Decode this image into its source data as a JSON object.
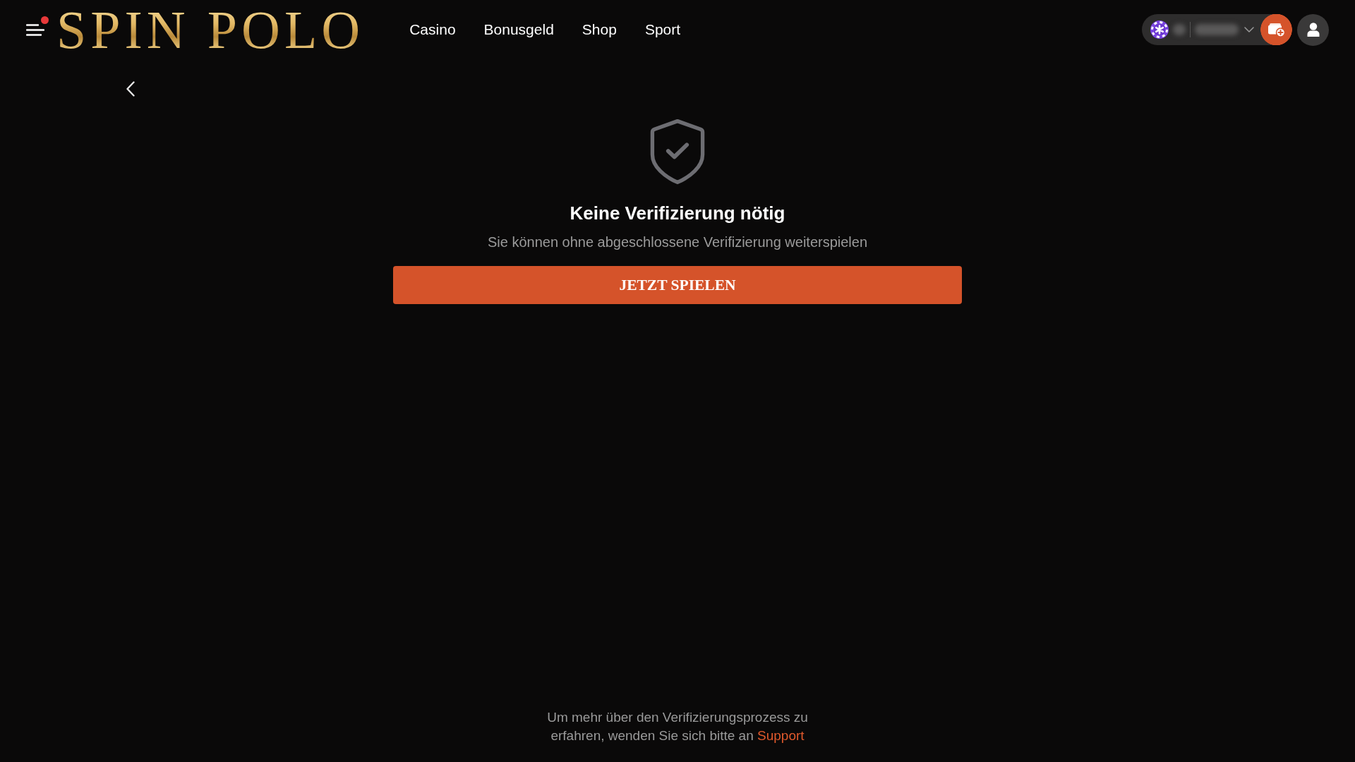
{
  "header": {
    "menu": {
      "has_notification": true
    },
    "logo": "SPIN POLO",
    "nav": [
      {
        "label": "Casino"
      },
      {
        "label": "Bonusgeld"
      },
      {
        "label": "Shop"
      },
      {
        "label": "Sport"
      }
    ]
  },
  "verification": {
    "title": "Keine Verifizierung nötig",
    "subtitle": "Sie können ohne abgeschlossene Verifizierung weiterspielen",
    "button": "JETZT SPIELEN"
  },
  "footer": {
    "text": "Um mehr über den Verifizierungsprozess zu erfahren, wenden Sie sich bitte an",
    "link": "Support"
  }
}
